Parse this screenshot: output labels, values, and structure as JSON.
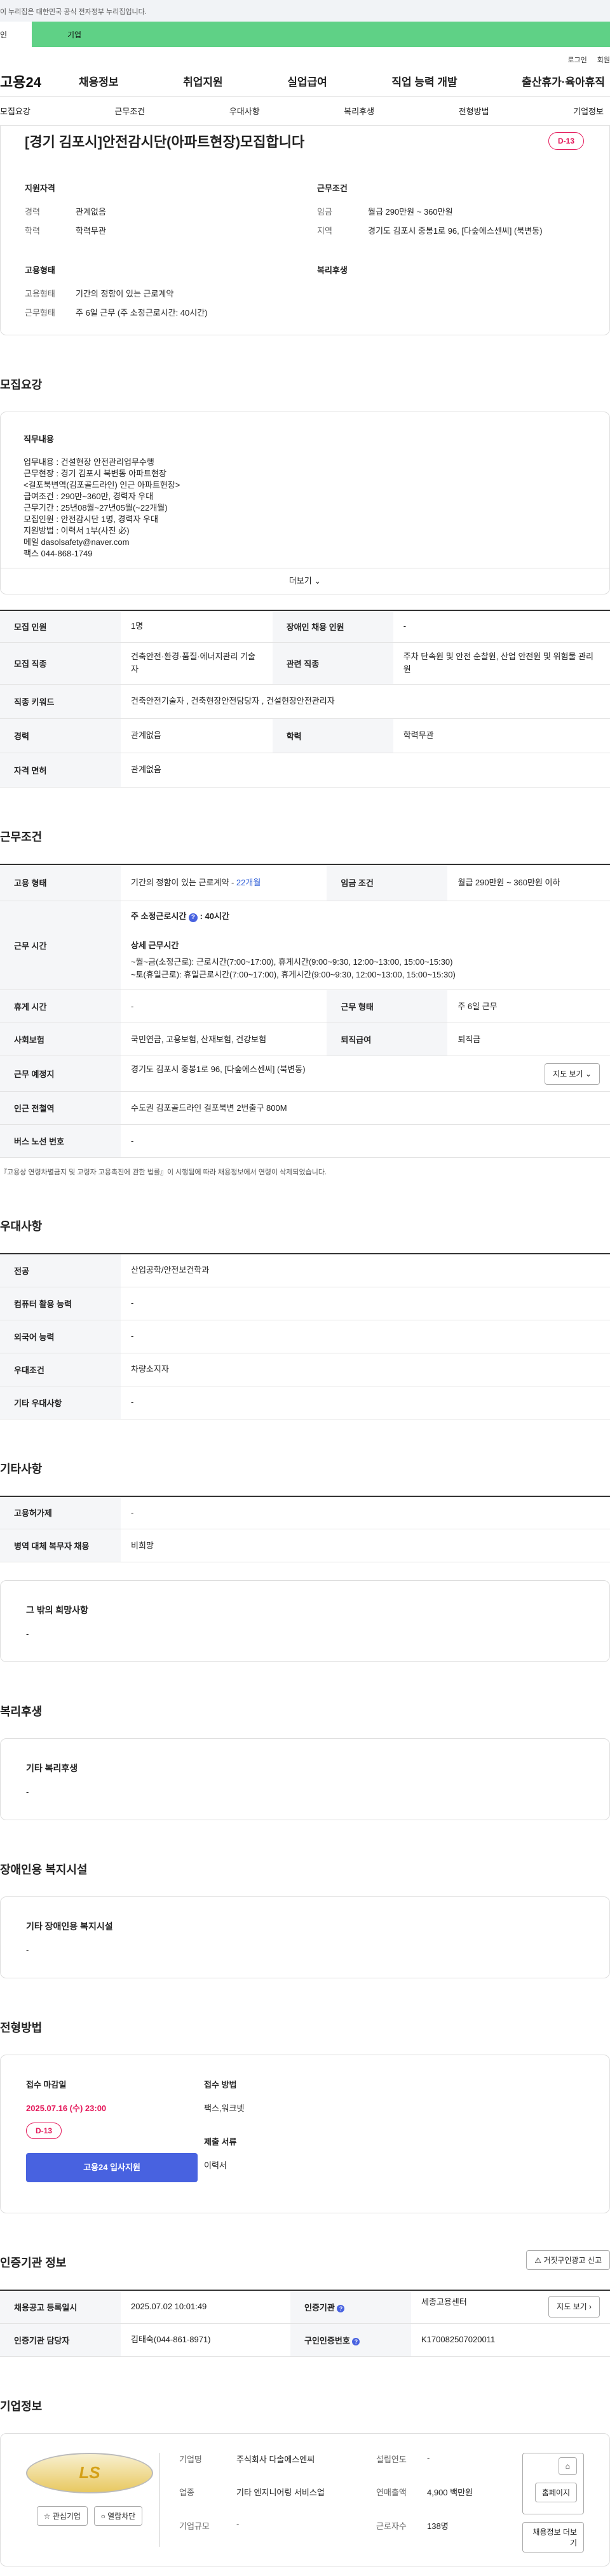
{
  "notice": "이 누리집은 대한민국 공식 전자정부 누리집입니다.",
  "greenbar": {
    "a": "인",
    "b": "기업"
  },
  "util": {
    "login": "로그인",
    "join": "회원"
  },
  "gnb": {
    "logo": "고용24",
    "menu": [
      "채용정보",
      "취업지원",
      "실업급여",
      "직업 능력 개발",
      "출산휴가·육아휴직"
    ]
  },
  "snb": [
    "모집요강",
    "근무조건",
    "우대사항",
    "복리후생",
    "전형방법",
    "기업정보"
  ],
  "title": "[경기 김포시]안전감시단(아파트현장)모집합니다",
  "dday": "D-13",
  "summary": {
    "qual_title": "지원자격",
    "career_k": "경력",
    "career_v": "관계없음",
    "edu_k": "학력",
    "edu_v": "학력무관",
    "emp_title": "고용형태",
    "emp_k": "고용형태",
    "emp_v": "기간의 정함이 있는 근로계약",
    "work_k": "근무형태",
    "work_v": "주 6일 근무 (주 소정근로시간: 40시간)",
    "cond_title": "근무조건",
    "wage_k": "임금",
    "wage_v": "월급 290만원 ~ 360만원",
    "area_k": "지역",
    "area_v": "경기도 김포시 중봉1로 96, [다숲에스센씨] (북변동)",
    "welfare_title": "복리후생"
  },
  "sec1": "모집요강",
  "duty": {
    "title": "직무내용",
    "lines": [
      "업무내용 : 건설현장 안전관리업무수행",
      "근무현장 : 경기 김포시 북변동 아파트현장",
      "<걸포북변역(김포골드라인) 인근 아파트현장>",
      "급여조건 : 290만~360만, 경력자 우대",
      "근무기간 : 25년08월~27년05월(~22개월)",
      "모집인원 : 안전감시단 1명, 경력자 우대",
      "지원방법 : 이력서 1부(사진 必)",
      "메일 dasolsafety@naver.com",
      "팩스 044-868-1749"
    ],
    "more": "더보기"
  },
  "recruit": [
    [
      "모집 인원",
      "1명",
      "장애인 채용 인원",
      "-"
    ],
    [
      "모집 직종",
      "건축안전·환경·품질·에너지관리 기술자",
      "관련 직종",
      "주차 단속원 및 안전 순찰원, 산업 안전원 및 위험물 관리원"
    ],
    [
      "직종 키워드",
      "건축안전기술자 , 건축현장안전담당자 , 건설현장안전관리자"
    ],
    [
      "경력",
      "관계없음",
      "학력",
      "학력무관"
    ],
    [
      "자격 면허",
      "관계없음"
    ]
  ],
  "sec2": "근무조건",
  "cond": {
    "emp_k": "고용 형태",
    "emp_v": "기간의 정함이 있는 근로계약 - ",
    "emp_link": "22개월",
    "wage_k": "임금 조건",
    "wage_v": "월급 290만원 ~ 360만원 이하",
    "time_k": "근무 시간",
    "time_a": "주 소정근로시간",
    "time_b": "40시간",
    "detail": "상세 근무시간",
    "d1": "~월~금(소정근로): 근로시간(7:00~17:00), 휴게시간(9:00~9:30, 12:00~13:00, 15:00~15:30)",
    "d2": "~토(휴일근로): 휴일근로시간(7:00~17:00), 휴게시간(9:00~9:30, 12:00~13:00, 15:00~15:30)",
    "rest_k": "휴게 시간",
    "rest_v": "-",
    "form_k": "근무 형태",
    "form_v": "주 6일 근무",
    "ins_k": "사회보험",
    "ins_v": "국민연금, 고용보험, 산재보험, 건강보험",
    "ret_k": "퇴직급여",
    "ret_v": "퇴직금",
    "place_k": "근무 예정지",
    "place_v": "경기도 김포시 중봉1로 96, [다숲에스센씨] (북변동)",
    "map": "지도 보기",
    "sub_k": "인근 전철역",
    "sub_v": "수도권 김포골드라인 걸포북변 2번출구 800M",
    "bus_k": "버스 노선 번호",
    "bus_v": "-",
    "note": "『고용상 연령차별금지 및 고령자 고용촉진에 관한 법률』이 시행됨에 따라 채용정보에서 연령이 삭제되었습니다."
  },
  "sec3": "우대사항",
  "pref": [
    [
      "전공",
      "산업공학/안전보건학과"
    ],
    [
      "컴퓨터 활용 능력",
      "-"
    ],
    [
      "외국어 능력",
      "-"
    ],
    [
      "우대조건",
      "차량소지자"
    ],
    [
      "기타 우대사항",
      "-"
    ]
  ],
  "sec4": "기타사항",
  "etc": [
    [
      "고용허가제",
      "-"
    ],
    [
      "병역 대체 복무자 채용",
      "비희망"
    ]
  ],
  "etc_box": {
    "title": "그 밖의 희망사항",
    "v": "-"
  },
  "sec5": "복리후생",
  "wel_box": {
    "title": "기타 복리후생",
    "v": "-"
  },
  "sec6": "장애인용 복지시설",
  "dis_box": {
    "title": "기타 장애인용 복지시설",
    "v": "-"
  },
  "sec7": "전형방법",
  "apply": {
    "deadline_k": "접수 마감일",
    "deadline_v": "2025.07.16 (수) 23:00",
    "dday": "D-13",
    "btn": "고용24 입사지원",
    "method_k": "접수 방법",
    "method_v": "팩스,워크넷",
    "docs_k": "제출 서류",
    "docs_v": "이력서"
  },
  "sec8": "인증기관 정보",
  "report": "거짓구인광고 신고",
  "cert": [
    [
      "채용공고 등록일시",
      "2025.07.02 10:01:49",
      "인증기관",
      "세종고용센터"
    ],
    [
      "인증기관 담당자",
      "김태숙(044-861-8971)",
      "구인인증번호",
      "K170082507020011"
    ]
  ],
  "sec9": "기업정보",
  "company": {
    "logo": "LS",
    "fav": "관심기업",
    "block": "열람차단",
    "name_k": "기업명",
    "name_v": "주식회사 다솔에스엔씨",
    "ind_k": "업종",
    "ind_v": "기타 엔지니어링 서비스업",
    "size_k": "기업규모",
    "size_v": "-",
    "year_k": "설립연도",
    "year_v": "-",
    "sales_k": "연매출액",
    "sales_v": "4,900 백만원",
    "emp_k": "근로자수",
    "emp_v": "138명",
    "home": "홈페이지",
    "info": "채용정보 더보기"
  }
}
